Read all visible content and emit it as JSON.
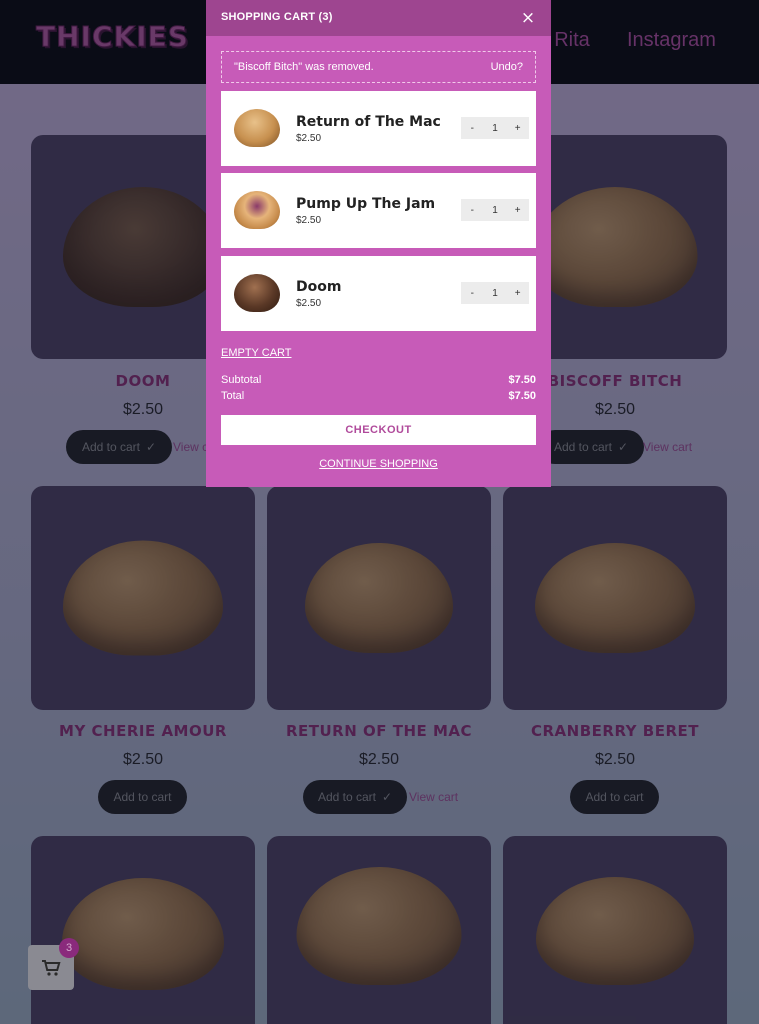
{
  "header": {
    "logo": "THICKIES",
    "nav": [
      "ut Rita",
      "Instagram"
    ]
  },
  "products": [
    {
      "name": "DOOM",
      "price": "$2.50",
      "add_label": "Add to cart",
      "view_cart": "View c"
    },
    {
      "name": "BISCOFF BITCH",
      "price": "$2.50",
      "add_label": "Add to cart",
      "view_cart": "View cart"
    },
    {
      "name": "MY CHERIE AMOUR",
      "price": "$2.50",
      "add_label": "Add to cart"
    },
    {
      "name": "RETURN OF THE MAC",
      "price": "$2.50",
      "add_label": "Add to cart",
      "view_cart": "View cart"
    },
    {
      "name": "CRANBERRY BERET",
      "price": "$2.50",
      "add_label": "Add to cart"
    }
  ],
  "cart": {
    "title": "SHOPPING CART (3)",
    "close": "×",
    "notice": "\"Biscoff Bitch\" was removed.",
    "undo": "Undo?",
    "items": [
      {
        "name": "Return of The Mac",
        "price": "$2.50",
        "minus": "-",
        "qty": "1",
        "plus": "+"
      },
      {
        "name": "Pump Up The Jam",
        "price": "$2.50",
        "minus": "-",
        "qty": "1",
        "plus": "+"
      },
      {
        "name": "Doom",
        "price": "$2.50",
        "minus": "-",
        "qty": "1",
        "plus": "+"
      }
    ],
    "empty": "EMPTY CART",
    "subtotal_label": "Subtotal",
    "subtotal": "$7.50",
    "total_label": "Total",
    "total": "$7.50",
    "checkout": "CHECKOUT",
    "continue": "CONTINUE SHOPPING"
  },
  "mini_cart": {
    "count": "3",
    "icon": "cart-icon"
  }
}
